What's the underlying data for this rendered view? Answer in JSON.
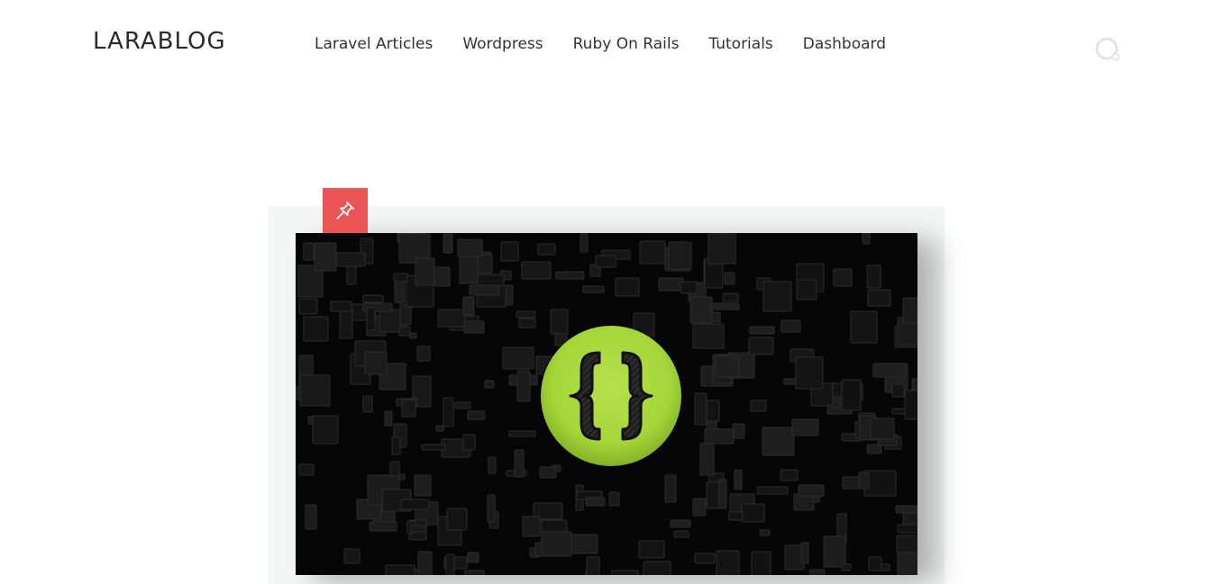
{
  "site": {
    "logo": "LARABLOG"
  },
  "nav": {
    "items": [
      {
        "label": "Laravel Articles"
      },
      {
        "label": "Wordpress"
      },
      {
        "label": "Ruby On Rails"
      },
      {
        "label": "Tutorials"
      },
      {
        "label": "Dashboard"
      }
    ]
  },
  "icons": {
    "search": "search-icon",
    "pin": "pushpin-icon",
    "post_image": "curly-braces-logo"
  },
  "colors": {
    "accent": "#ea5455",
    "logo_green": "#a4d63a",
    "card_bg": "#f4f5f5"
  }
}
